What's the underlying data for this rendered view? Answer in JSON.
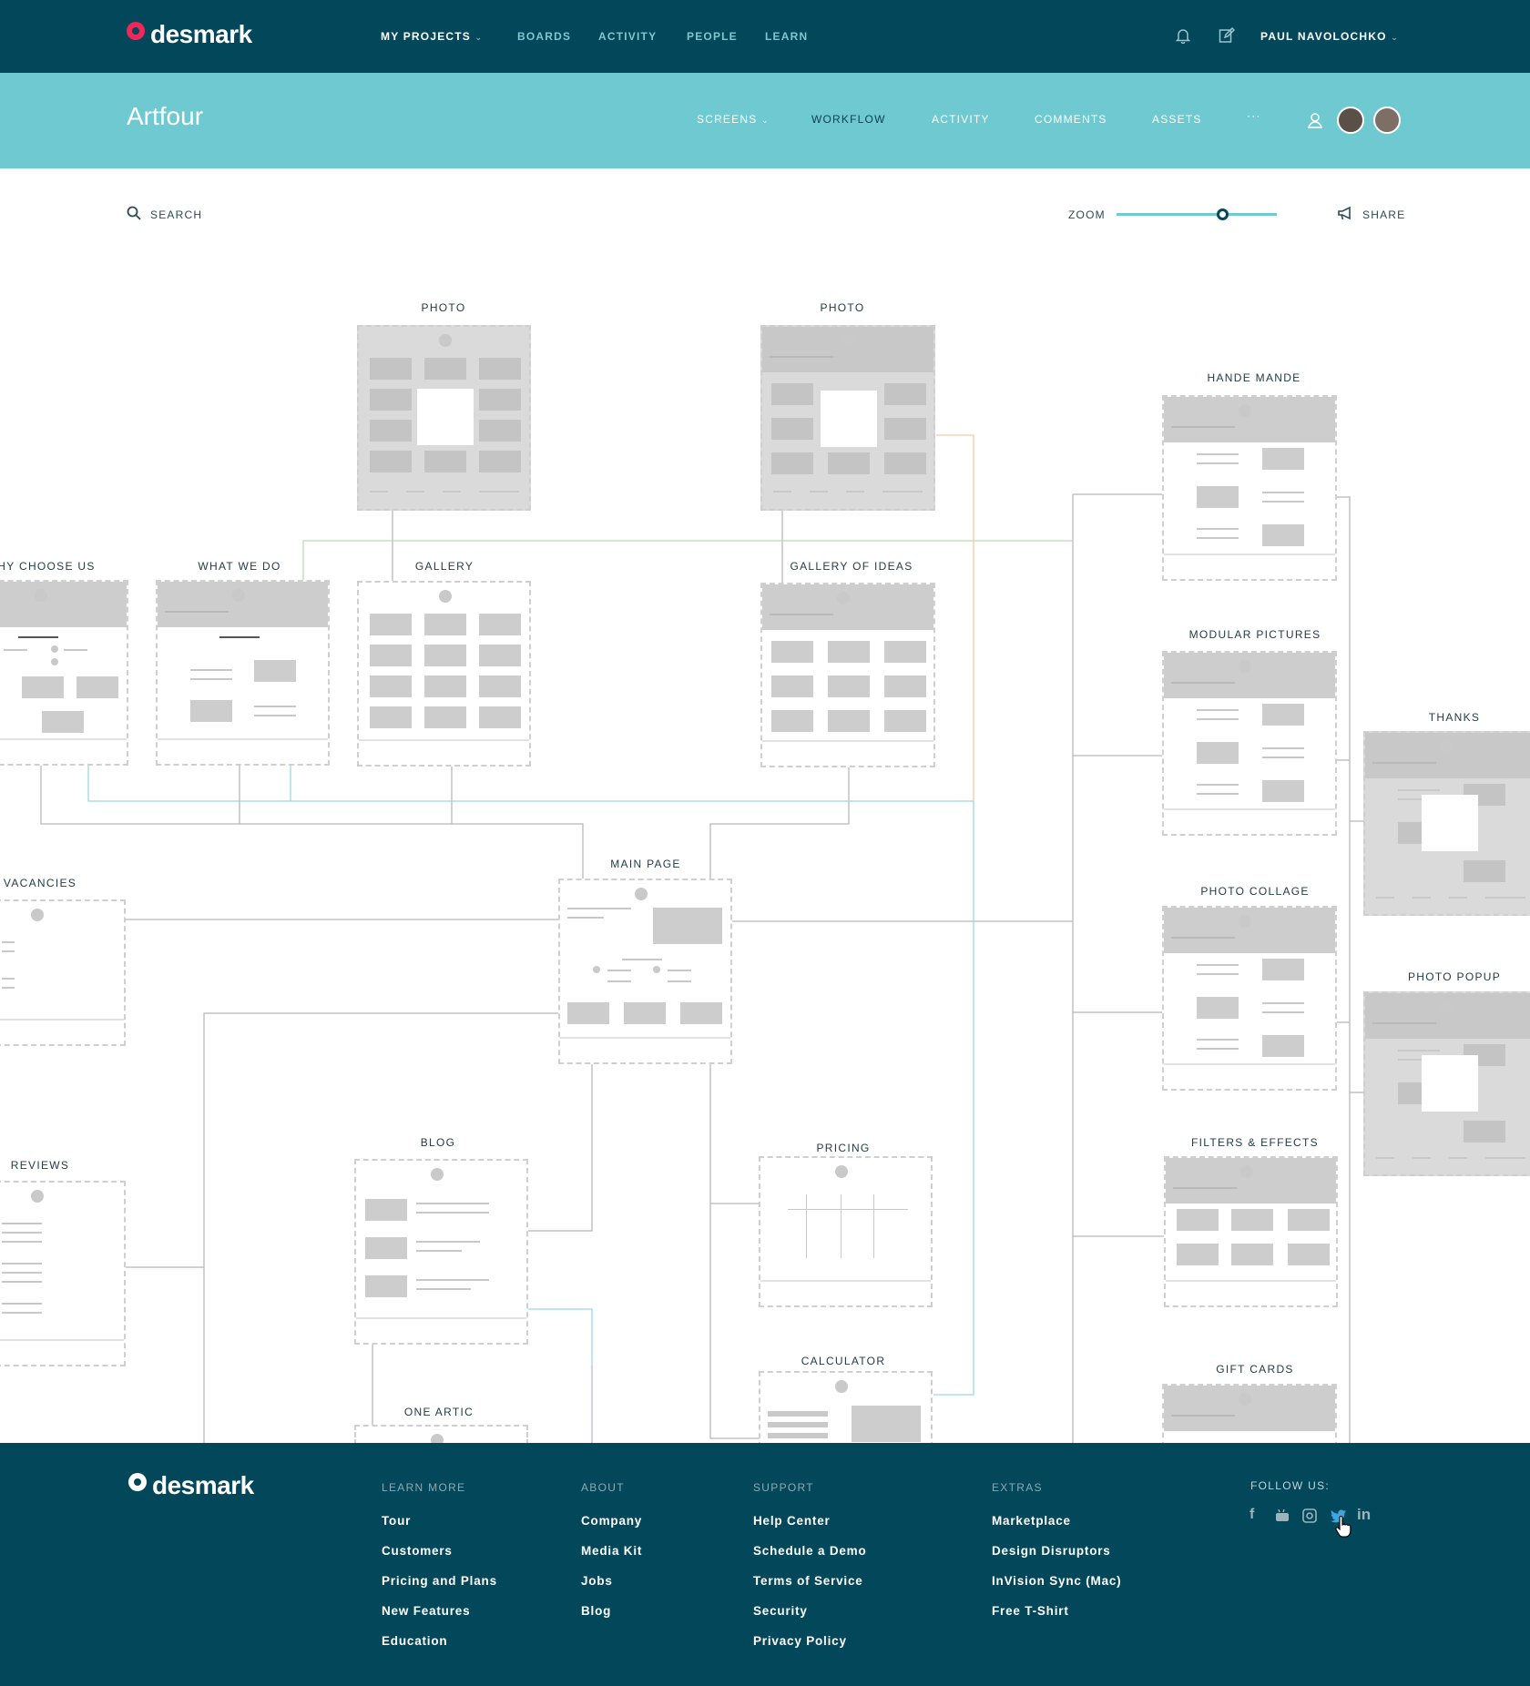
{
  "header": {
    "brand": "desmark",
    "nav": [
      "MY PROJECTS",
      "BOARDS",
      "ACTIVITY",
      "PEOPLE",
      "LEARN"
    ],
    "user": "PAUL NAVOLOCHKO"
  },
  "project": {
    "title": "Artfour",
    "tabs": [
      "SCREENS",
      "WORKFLOW",
      "ACTIVITY",
      "COMMENTS",
      "ASSETS",
      "···"
    ]
  },
  "toolbar": {
    "search": "SEARCH",
    "zoom": "ZOOM",
    "zoom_level": 0.66,
    "share": "SHARE"
  },
  "screens": {
    "photo1": "PHOTO",
    "photo2": "PHOTO",
    "hande": "HANDE MANDE",
    "why": "HY CHOOSE US",
    "whatwe": "WHAT WE DO",
    "gallery": "GALLERY",
    "ideas": "GALLERY OF IDEAS",
    "modular": "MODULAR PICTURES",
    "thanks": "THANKS",
    "vacancies": "VACANCIES",
    "mainpage": "MAIN PAGE",
    "collage": "PHOTO COLLAGE",
    "popup": "PHOTO POPUP",
    "reviews": "REVIEWS",
    "blog": "BLOG",
    "pricing": "PRICING",
    "filters": "FILTERS & EFFECTS",
    "calculator": "CALCULATOR",
    "giftcards": "GIFT CARDS",
    "article": "ONE ARTIC"
  },
  "colors": {
    "navy": "#03475a",
    "teal": "#6ec9d1",
    "pink": "#f0285a"
  },
  "footer": {
    "brand": "desmark",
    "columns": [
      {
        "heading": "LEARN MORE",
        "items": [
          "Tour",
          "Customers",
          "Pricing and Plans",
          "New Features",
          "Education"
        ]
      },
      {
        "heading": "ABOUT",
        "items": [
          "Company",
          "Media Kit",
          "Jobs",
          "Blog"
        ]
      },
      {
        "heading": "SUPPORT",
        "items": [
          "Help Center",
          "Schedule a Demo",
          "Terms of Service",
          "Security",
          "Privacy Policy"
        ]
      },
      {
        "heading": "EXTRAS",
        "items": [
          "Marketplace",
          "Design Disruptors",
          "InVision Sync (Mac)",
          "Free T-Shirt"
        ]
      }
    ],
    "follow": "FOLLOW US:",
    "social": [
      "facebook-icon",
      "youtube-icon",
      "instagram-icon",
      "twitter-icon",
      "linkedin-icon"
    ]
  }
}
